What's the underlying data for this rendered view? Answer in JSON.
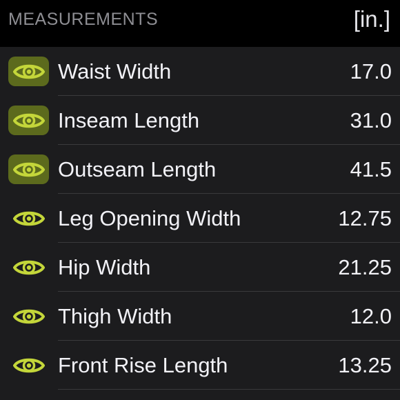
{
  "header": {
    "title": "MEASUREMENTS",
    "unit": "[in.]"
  },
  "colors": {
    "accent": "#c4d63a",
    "active_badge": "#5c6a1d",
    "background": "#1c1c1e",
    "header_background": "#000000"
  },
  "measurements": [
    {
      "label": "Waist Width",
      "value": "17.0",
      "icon": "eye-icon",
      "highlighted": true
    },
    {
      "label": "Inseam Length",
      "value": "31.0",
      "icon": "eye-icon",
      "highlighted": true
    },
    {
      "label": "Outseam Length",
      "value": "41.5",
      "icon": "eye-icon",
      "highlighted": true
    },
    {
      "label": "Leg Opening Width",
      "value": "12.75",
      "icon": "eye-icon",
      "highlighted": false
    },
    {
      "label": "Hip Width",
      "value": "21.25",
      "icon": "eye-icon",
      "highlighted": false
    },
    {
      "label": "Thigh Width",
      "value": "12.0",
      "icon": "eye-icon",
      "highlighted": false
    },
    {
      "label": "Front Rise Length",
      "value": "13.25",
      "icon": "eye-icon",
      "highlighted": false
    }
  ]
}
